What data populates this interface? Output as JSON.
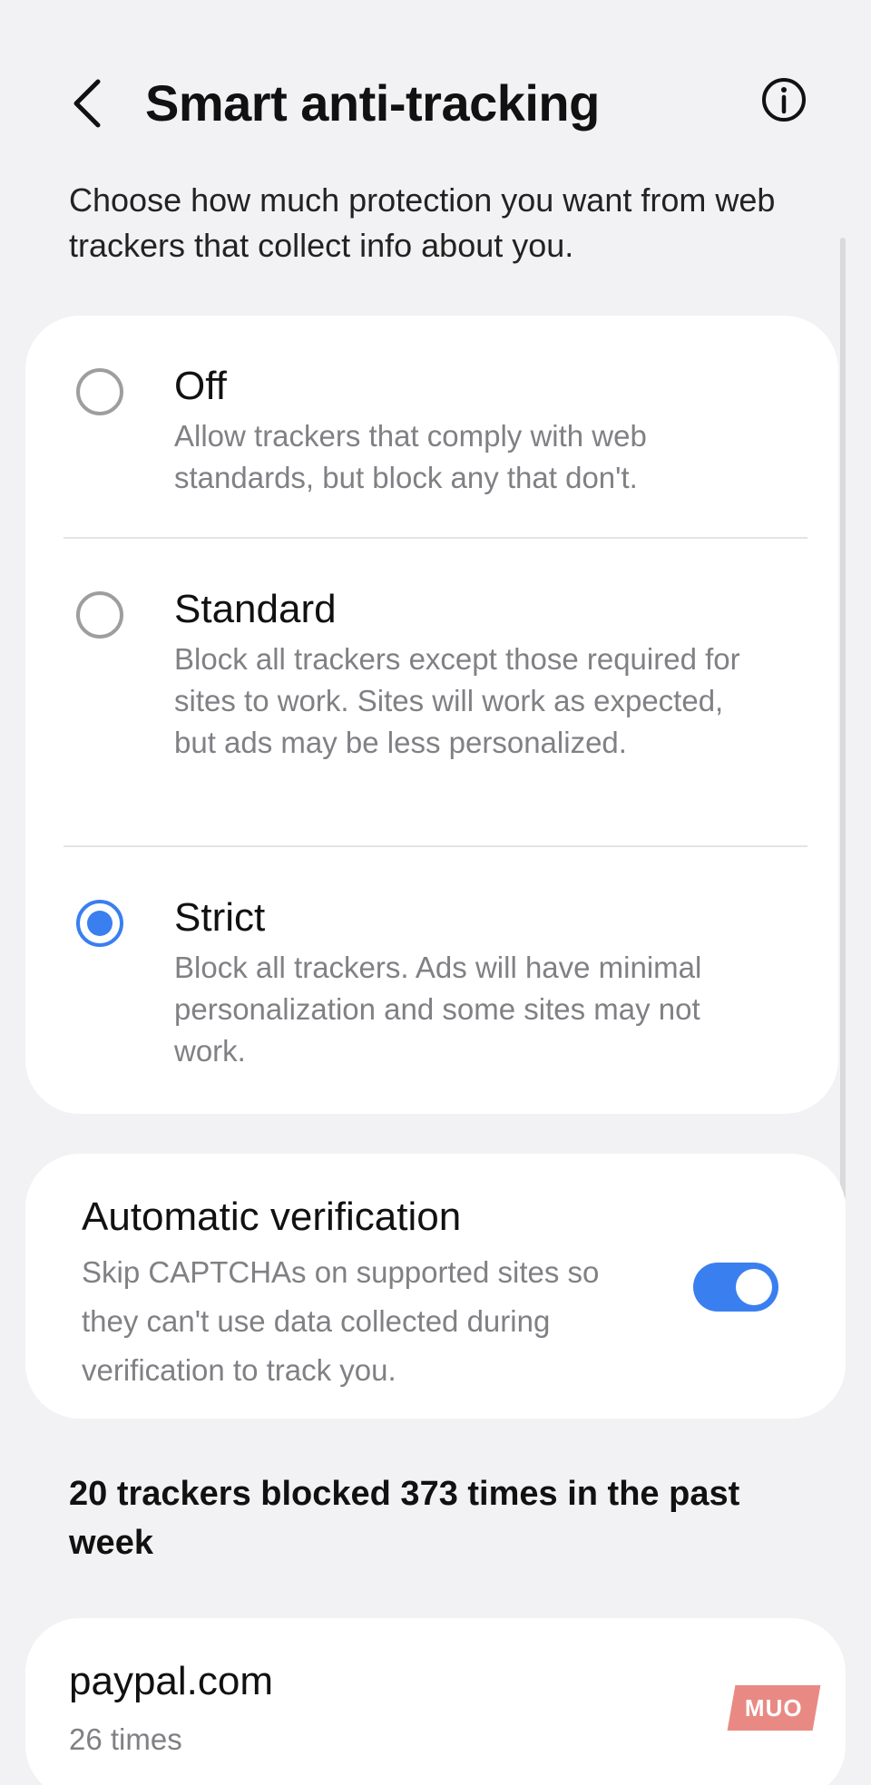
{
  "header": {
    "title": "Smart anti-tracking",
    "back_icon": "chevron-left-icon",
    "info_icon": "info-icon"
  },
  "intro": "Choose how much protection you want from web trackers that collect info about you.",
  "options": [
    {
      "label": "Off",
      "description": "Allow trackers that comply with web standards, but block any that don't.",
      "selected": false
    },
    {
      "label": "Standard",
      "description": "Block all trackers except those required for sites to work. Sites will work as expected, but ads may be less personalized.",
      "selected": false
    },
    {
      "label": "Strict",
      "description": "Block all trackers. Ads will have minimal personalization and some sites may not work.",
      "selected": true
    }
  ],
  "verification": {
    "title": "Automatic verification",
    "description": "Skip CAPTCHAs on supported sites so they can't use data collected during verification to track you.",
    "enabled": true
  },
  "stats": "20 trackers blocked 373 times in the past week",
  "sites": [
    {
      "name": "paypal.com",
      "count": "26 times"
    }
  ],
  "watermark": "MUO",
  "colors": {
    "accent": "#3a7ff0",
    "background": "#f2f2f4",
    "card": "#ffffff",
    "secondary_text": "#808085"
  }
}
